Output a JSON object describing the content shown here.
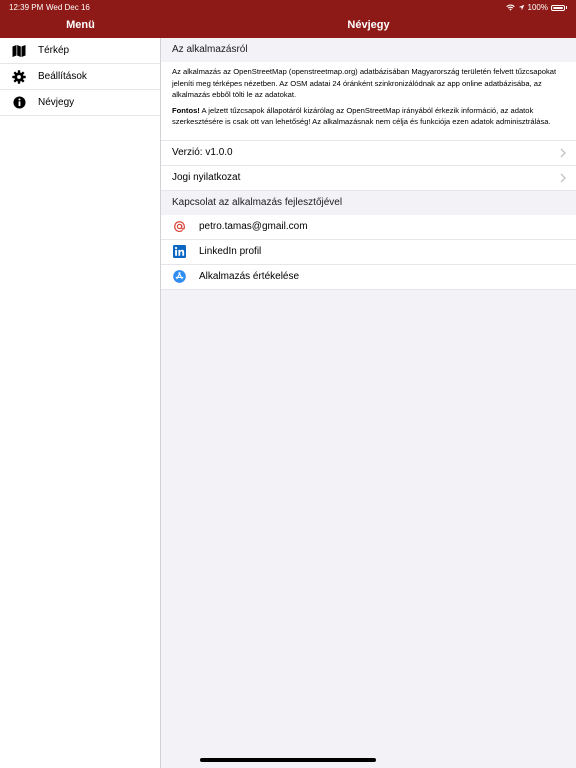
{
  "status": {
    "time": "12:39 PM",
    "date": "Wed Dec 16",
    "battery": "100%"
  },
  "sidebar": {
    "title": "Menü",
    "items": [
      {
        "label": "Térkép",
        "icon": "map-icon"
      },
      {
        "label": "Beállítások",
        "icon": "gear-icon"
      },
      {
        "label": "Névjegy",
        "icon": "info-icon"
      }
    ]
  },
  "main": {
    "title": "Névjegy",
    "about": {
      "header": "Az alkalmazásról",
      "paragraph1": "Az alkalmazás az OpenStreetMap (openstreetmap.org) adatbázisában Magyarország területén felvett tűzcsapokat jeleníti meg térképes nézetben. Az OSM adatai 24 óránként szinkronizálódnak az app online adatbázisába, az alkalmazás ebből tölti le az adatokat.",
      "important_label": "Fontos!",
      "paragraph2": " A jelzett tűzcsapok állapotáról kizárólag az OpenStreetMap irányából érkezik információ, az adatok szerkesztésére is csak ott van lehetőség! Az alkalmazásnak nem célja és funkciója ezen adatok adminisztrálása."
    },
    "version_label": "Verzió: v1.0.0",
    "legal_label": "Jogi nyilatkozat",
    "contact": {
      "header": "Kapcsolat az alkalmazás fejlesztőjével",
      "items": [
        {
          "label": "petro.tamas@gmail.com",
          "icon": "at-icon"
        },
        {
          "label": "LinkedIn profil",
          "icon": "linkedin-icon"
        },
        {
          "label": "Alkalmazás értékelése",
          "icon": "app-store-icon"
        }
      ]
    }
  },
  "colors": {
    "header": "#8d1a16",
    "background": "#f2f2f7",
    "accent_at": "#d9463b",
    "linkedin": "#0a66c2",
    "app_store": "#2f8cf0"
  }
}
